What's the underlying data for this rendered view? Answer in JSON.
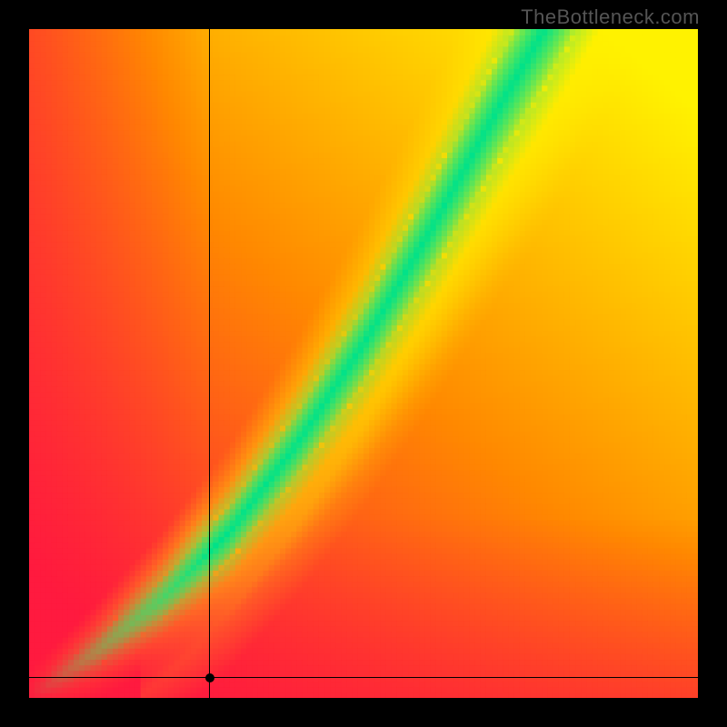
{
  "watermark": "TheBottleneck.com",
  "chart_data": {
    "type": "heatmap",
    "title": "",
    "xlabel": "",
    "ylabel": "",
    "xlim": [
      0,
      100
    ],
    "ylim": [
      0,
      100
    ],
    "resolution": 120,
    "colors": {
      "red": "#ff1a3f",
      "orange": "#ff8a00",
      "yellow": "#fff200",
      "green": "#00e28a"
    },
    "marker": {
      "x": 27,
      "y": 3
    },
    "ridge": {
      "description": "optimal-pairing curve (green band)",
      "points": [
        {
          "x": 0,
          "y": 0
        },
        {
          "x": 10,
          "y": 7
        },
        {
          "x": 20,
          "y": 15
        },
        {
          "x": 30,
          "y": 25
        },
        {
          "x": 40,
          "y": 38
        },
        {
          "x": 50,
          "y": 53
        },
        {
          "x": 60,
          "y": 70
        },
        {
          "x": 70,
          "y": 88
        },
        {
          "x": 77,
          "y": 100
        }
      ],
      "full_width_at_top": 18,
      "full_width_at_bottom": 3
    },
    "secondary_ridge": {
      "description": "faint yellow echo band below main ridge",
      "offset_y": -12
    },
    "background_gradient": "red (left) through orange to yellow (upper-right)"
  }
}
